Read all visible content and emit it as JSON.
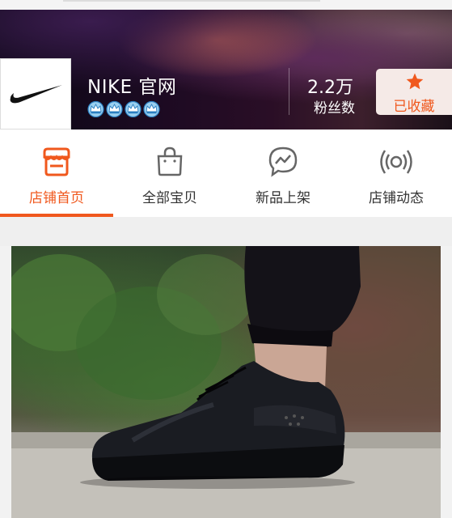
{
  "shop": {
    "name": "NIKE 官网",
    "logo_icon": "nike-swoosh-logo",
    "crown_count": 4,
    "crown_icon": "blue-crown-icon",
    "fans_count": "2.2万",
    "fans_label": "粉丝数",
    "favorite_label": "已收藏",
    "favorite_icon": "star-icon"
  },
  "tabs": [
    {
      "label": "店铺首页",
      "icon": "store-icon",
      "active": true
    },
    {
      "label": "全部宝贝",
      "icon": "shopping-bag-icon",
      "active": false
    },
    {
      "label": "新品上架",
      "icon": "new-arrival-bolt-icon",
      "active": false
    },
    {
      "label": "店铺动态",
      "icon": "broadcast-icon",
      "active": false
    }
  ],
  "colors": {
    "accent": "#f0581d",
    "tab_text": "#333333",
    "background": "#f2f2f2"
  },
  "banner": {
    "image": "black-sneaker-photo"
  }
}
